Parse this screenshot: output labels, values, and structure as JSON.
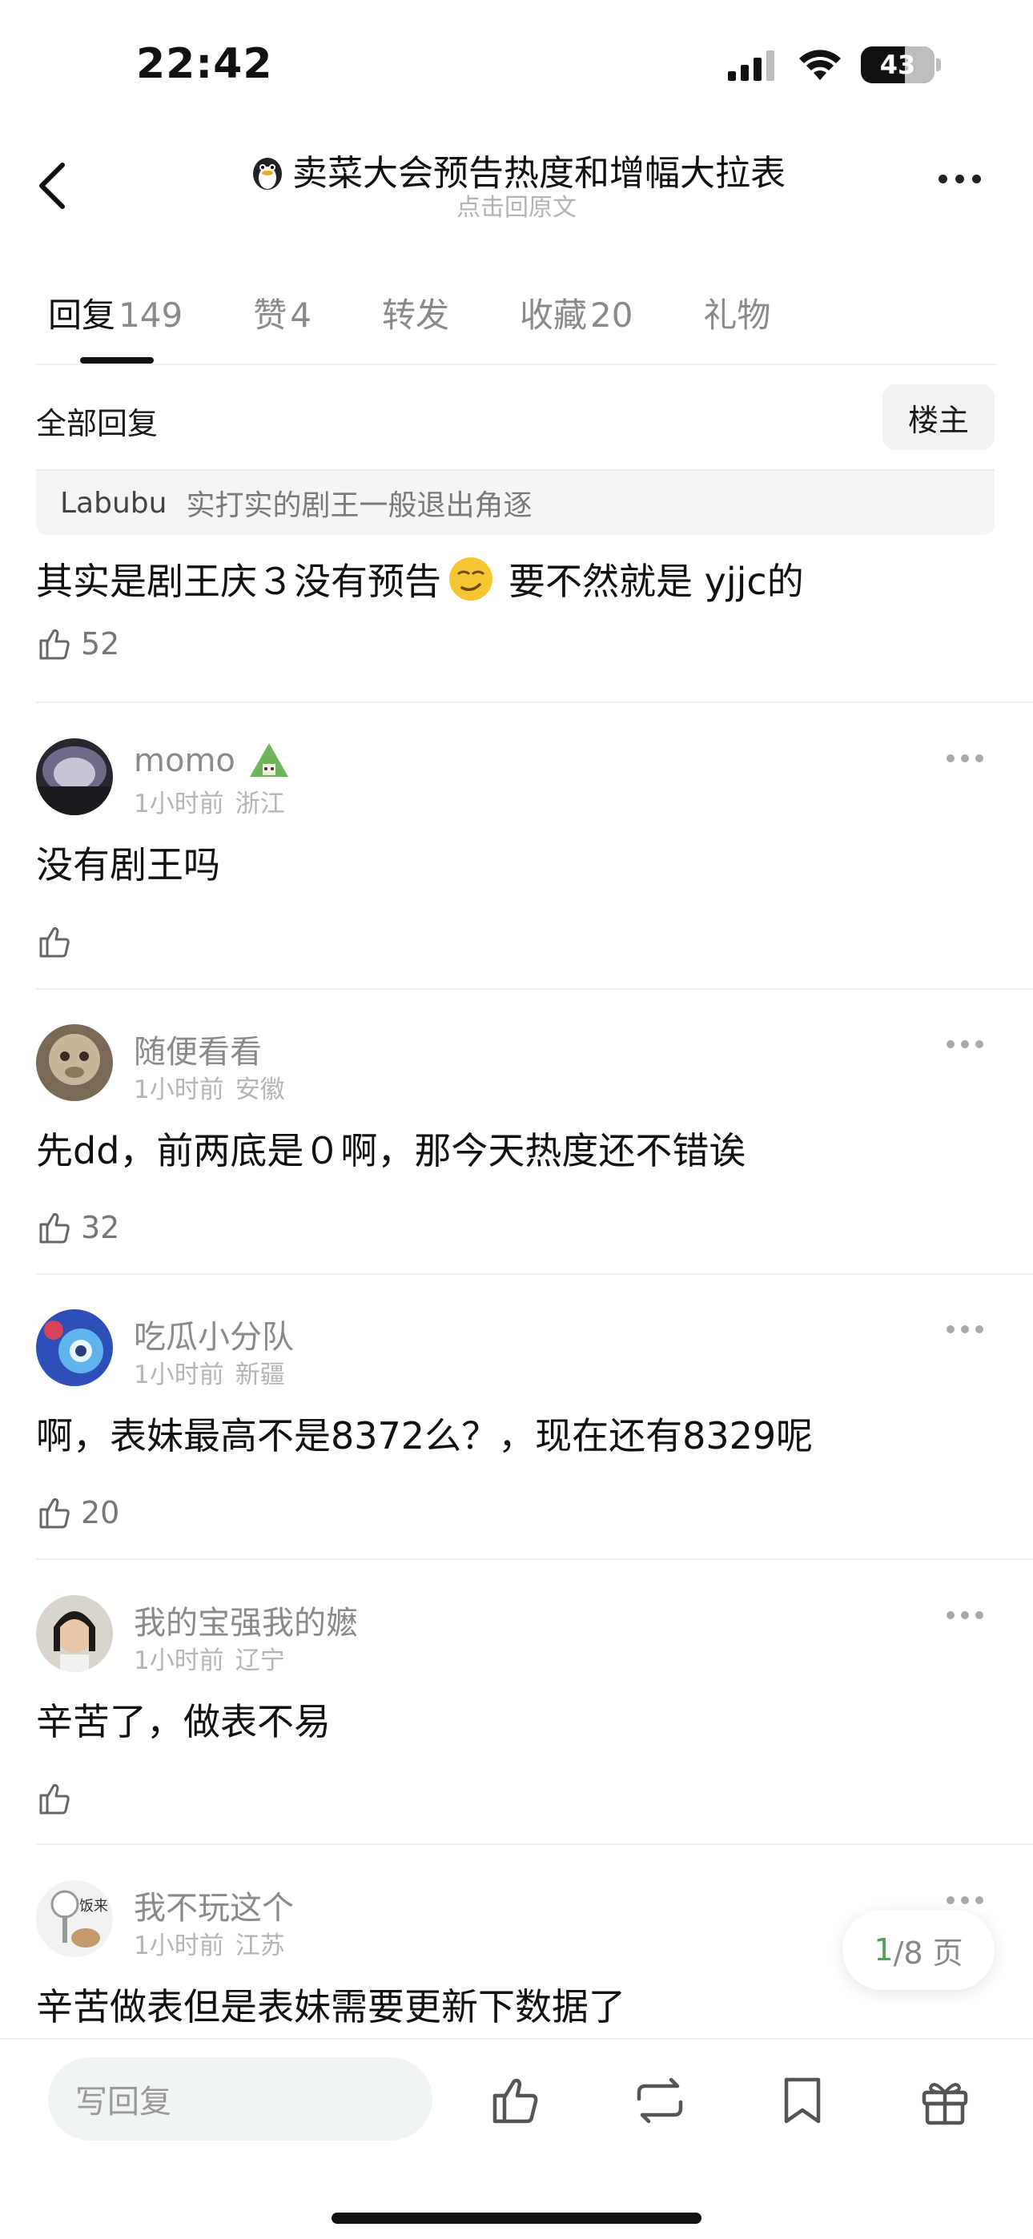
{
  "status_bar": {
    "time": "22:42",
    "battery": "43"
  },
  "header": {
    "title": "卖菜大会预告热度和增幅大拉表",
    "subtitle": "点击回原文"
  },
  "tabs": [
    {
      "label": "回复",
      "count": "149"
    },
    {
      "label": "赞",
      "count": "4"
    },
    {
      "label": "转发",
      "count": ""
    },
    {
      "label": "收藏",
      "count": "20"
    },
    {
      "label": "礼物",
      "count": ""
    }
  ],
  "section": {
    "all_replies": "全部回复",
    "op_only": "楼主"
  },
  "quote": {
    "author": "Labubu",
    "text": "实打实的剧王一般退出角逐"
  },
  "main_reply": {
    "text_before": "其实是剧王庆３没有预告",
    "text_after": "要不然就是 yjjc的",
    "likes": "52"
  },
  "comments": [
    {
      "name": "momo",
      "time": "1小时前",
      "location": "浙江",
      "text": "没有剧王吗",
      "likes": ""
    },
    {
      "name": "随便看看",
      "time": "1小时前",
      "location": "安徽",
      "text": "先dd，前两底是０啊，那今天热度还不错诶",
      "likes": "32"
    },
    {
      "name": "吃瓜小分队",
      "time": "1小时前",
      "location": "新疆",
      "text": "啊，表妹最高不是8372么？，现在还有8329呢",
      "likes": "20"
    },
    {
      "name": "我的宝强我的嬷",
      "time": "1小时前",
      "location": "辽宁",
      "text": "辛苦了，做表不易",
      "likes": ""
    },
    {
      "name": "我不玩这个",
      "time": "1小时前",
      "location": "江苏",
      "text": "辛苦做表但是表妹需要更新下数据了",
      "likes": ""
    }
  ],
  "pager": {
    "current": "1",
    "total_text": "/8 页"
  },
  "bottom_bar": {
    "reply_placeholder": "写回复"
  },
  "icons": [
    "back-icon",
    "more-icon",
    "thumb-up-icon",
    "repost-icon",
    "bookmark-icon",
    "gift-icon"
  ],
  "colors": {
    "accent_green": "#4aa55b",
    "input_bg": "#f1f5f1"
  }
}
